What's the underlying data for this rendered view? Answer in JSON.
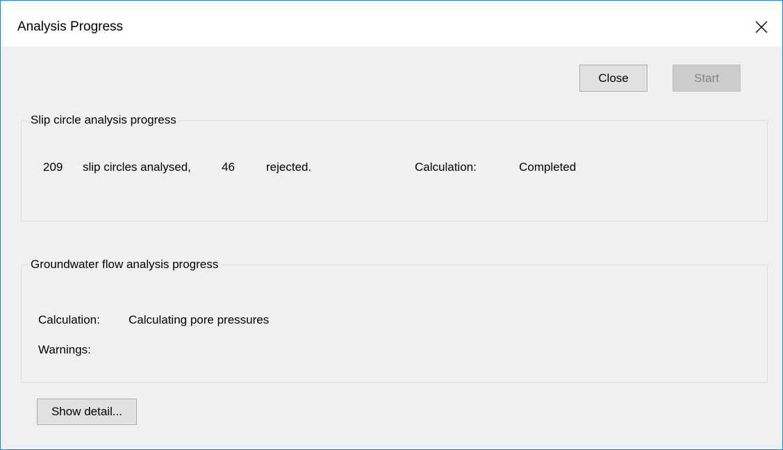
{
  "window": {
    "title": "Analysis Progress",
    "close_icon": "close-icon"
  },
  "buttons": {
    "close_label": "Close",
    "start_label": "Start",
    "start_enabled": false,
    "show_detail_label": "Show detail..."
  },
  "slip_circle": {
    "group_label": "Slip circle analysis progress",
    "analysed_count": "209",
    "analysed_text": "slip circles analysed,",
    "rejected_count": "46",
    "rejected_text": "rejected.",
    "calc_label": "Calculation:",
    "calc_status": "Completed"
  },
  "groundwater": {
    "group_label": "Groundwater flow analysis progress",
    "calc_label": "Calculation:",
    "calc_status": "Calculating pore pressures",
    "warnings_label": "Warnings:",
    "warnings_value": ""
  },
  "colors": {
    "window_border": "#1883d7",
    "dialog_background": "#f0f0f0",
    "titlebar_background": "#ffffff",
    "button_face": "#e1e1e1",
    "disabled_button_face": "#cccccc",
    "disabled_text": "#838383"
  }
}
